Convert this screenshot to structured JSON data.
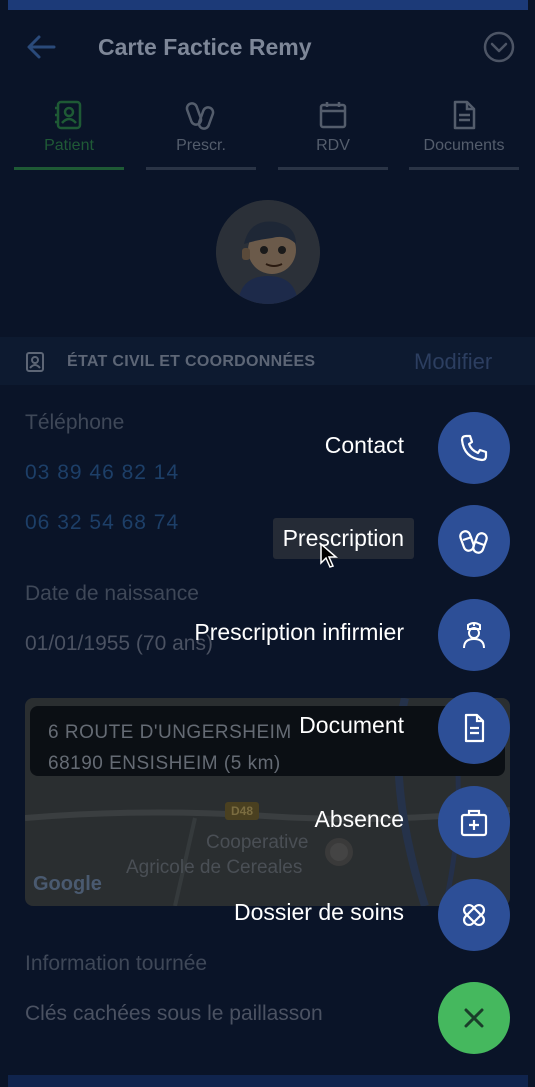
{
  "header": {
    "title": "Carte Factice Remy"
  },
  "tabs": [
    {
      "label": "Patient",
      "icon": "patient-card-icon",
      "active": true
    },
    {
      "label": "Prescr.",
      "icon": "pills-icon",
      "active": false
    },
    {
      "label": "RDV",
      "icon": "calendar-icon",
      "active": false
    },
    {
      "label": "Documents",
      "icon": "document-icon",
      "active": false
    }
  ],
  "section": {
    "title": "ÉTAT CIVIL ET COORDONNÉES",
    "edit_label": "Modifier"
  },
  "fields": {
    "phone_label": "Téléphone",
    "phone1": "03 89 46 82 14",
    "phone2": "06 32 54 68 74",
    "birth_label": "Date de naissance",
    "birth_value": "01/01/1955 (70 ans)",
    "tour_label": "Information tournée",
    "tour_value": "Clés cachées sous le paillasson"
  },
  "map": {
    "address_line1": "6 ROUTE D'UNGERSHEIM",
    "address_line2": "68190 ENSISHEIM (5 km)",
    "road": "D48",
    "poi_line1": "Cooperative",
    "poi_line2": "Agricole de Cereales",
    "attribution": "Google"
  },
  "fab_menu": [
    {
      "label": "Contact",
      "icon": "phone-icon"
    },
    {
      "label": "Prescription",
      "icon": "pills-icon"
    },
    {
      "label": "Prescription infirmier",
      "icon": "nurse-icon"
    },
    {
      "label": "Document",
      "icon": "document-icon"
    },
    {
      "label": "Absence",
      "icon": "medical-bag-icon"
    },
    {
      "label": "Dossier de soins",
      "icon": "bandage-icon"
    }
  ],
  "colors": {
    "fab": "#2d4f97",
    "fab_close": "#45b85e",
    "overlay_background": "#0a1428",
    "active_tab": "#1e5a35"
  }
}
